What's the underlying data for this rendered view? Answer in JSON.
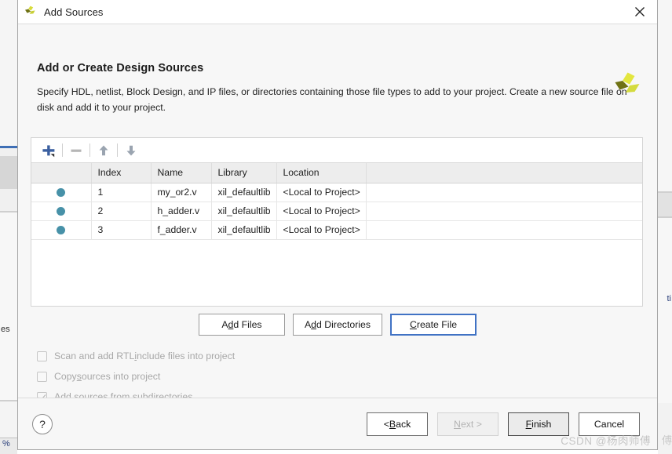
{
  "window": {
    "title": "Add Sources",
    "app_icon": "vivado-logo-icon",
    "close_icon": "close-icon"
  },
  "header": {
    "title": "Add or Create Design Sources",
    "description": "Specify HDL, netlist, Block Design, and IP files, or directories containing those file types to add to your project. Create a new source file on disk and add it to your project.",
    "brand_icon": "xilinx-logo-icon"
  },
  "toolbar": {
    "add_label": "+",
    "remove_label": "−",
    "move_up_label": "↑",
    "move_down_label": "↓",
    "add_icon": "plus-icon",
    "remove_icon": "minus-icon",
    "move_up_icon": "arrow-up-icon",
    "move_down_icon": "arrow-down-icon"
  },
  "table": {
    "columns": [
      "",
      "Index",
      "Name",
      "Library",
      "Location",
      ""
    ],
    "rows": [
      {
        "index": "1",
        "name": "my_or2.v",
        "library": "xil_defaultlib",
        "location": "<Local to Project>"
      },
      {
        "index": "2",
        "name": "h_adder.v",
        "library": "xil_defaultlib",
        "location": "<Local to Project>"
      },
      {
        "index": "3",
        "name": "f_adder.v",
        "library": "xil_defaultlib",
        "location": "<Local to Project>"
      }
    ]
  },
  "actions": {
    "add_files": {
      "pre": "A",
      "accel": "d",
      "post": "d Files"
    },
    "add_directories": {
      "pre": "A",
      "accel": "d",
      "post": "d Directories"
    },
    "create_file": {
      "pre": "",
      "accel": "C",
      "post": "reate File"
    }
  },
  "options": [
    {
      "label_pre": "Scan and add RTL ",
      "accel": "i",
      "label_post": "nclude files into project",
      "checked": false
    },
    {
      "label_pre": "Copy ",
      "accel": "s",
      "label_post": "ources into project",
      "checked": false
    },
    {
      "label_pre": "Add so",
      "accel": "u",
      "label_post": "rces from subdirectories",
      "checked": true
    }
  ],
  "footer": {
    "help_label": "?",
    "back": {
      "pre": "< ",
      "accel": "B",
      "post": "ack"
    },
    "next": {
      "pre": "",
      "accel": "N",
      "post": "ext >"
    },
    "finish": {
      "pre": "",
      "accel": "F",
      "post": "inish"
    },
    "cancel": {
      "pre": "",
      "accel": "",
      "post": "Cancel"
    }
  },
  "watermark": "CSDN @杨肉师傅",
  "background": {
    "left_text": "es",
    "left_percent": "%",
    "right_text": "ti",
    "right_watermark": "傅"
  },
  "colors": {
    "accent_blue": "#3f6fb5",
    "focus_blue": "#4072c4",
    "row_dot": "#4791a8",
    "brand_yellow": "#d8dc3c",
    "brand_olive": "#6f7214"
  }
}
